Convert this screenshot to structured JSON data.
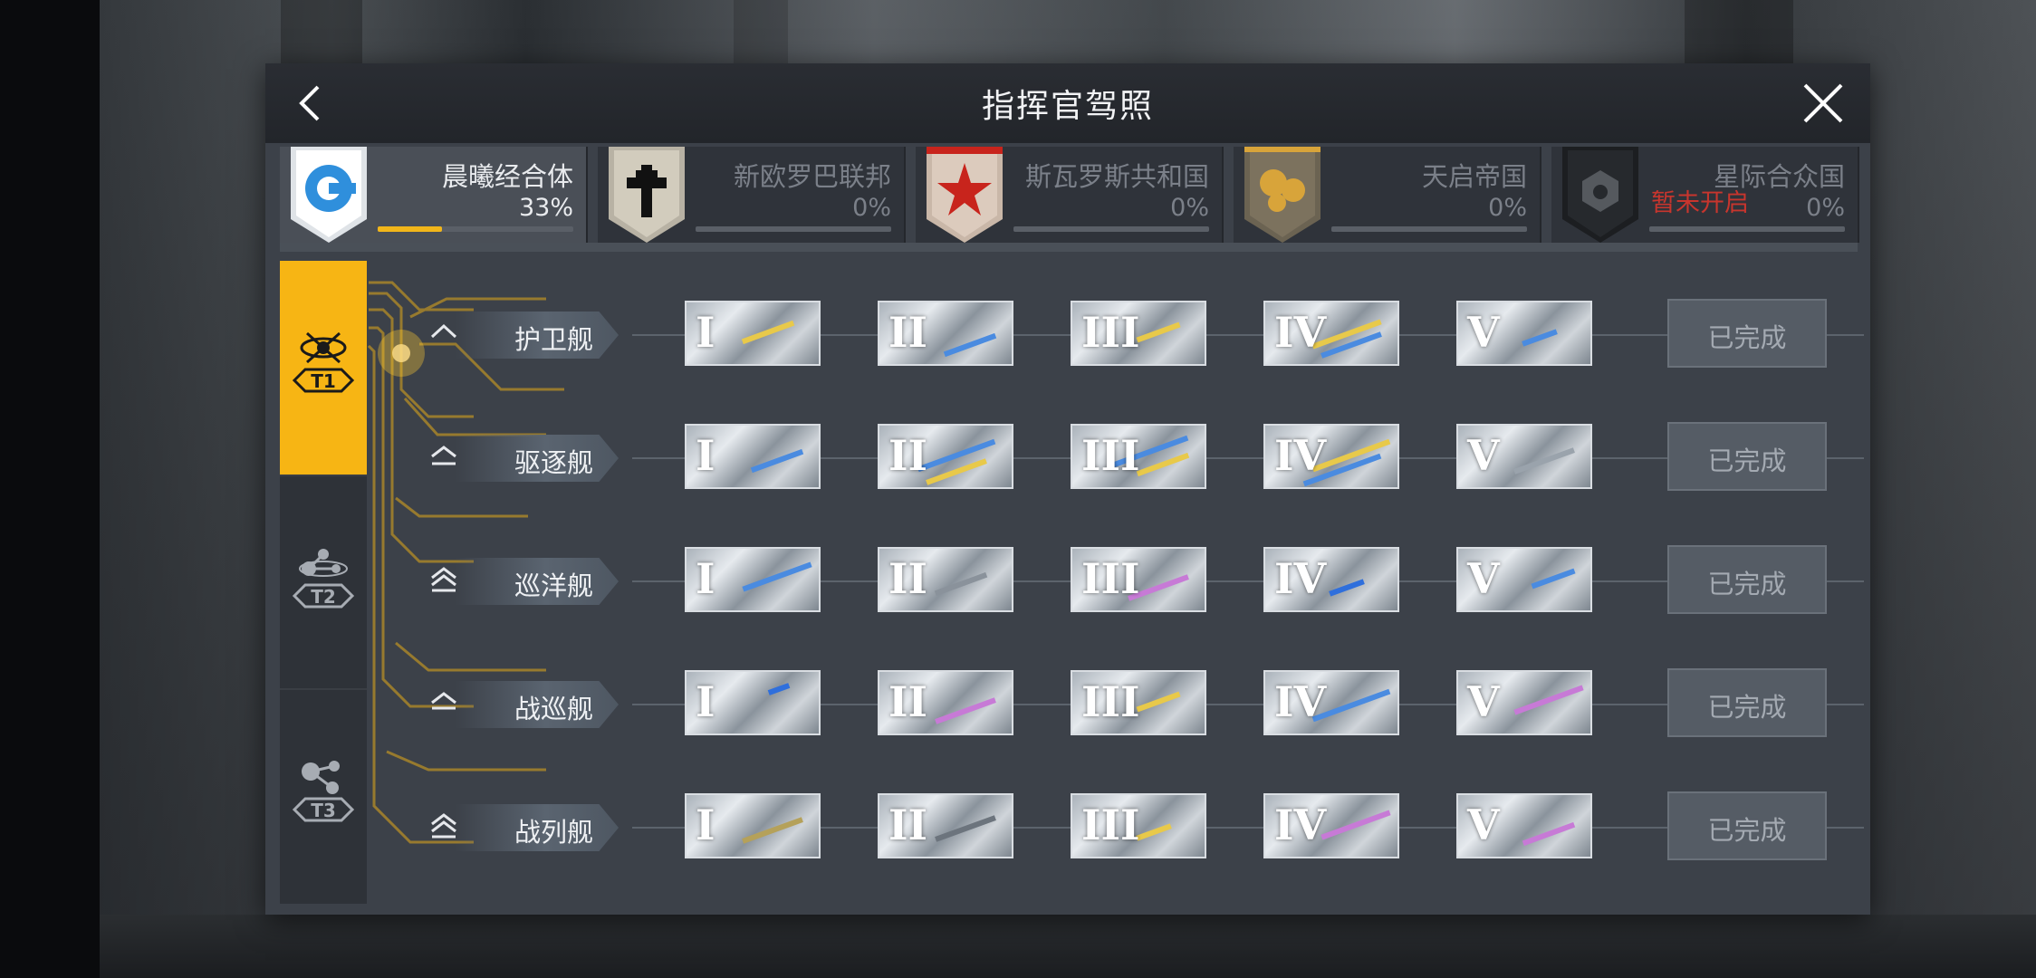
{
  "header": {
    "title": "指挥官驾照"
  },
  "factions": [
    {
      "name": "晨曦经合体",
      "percent": "33%",
      "progress": 0.33,
      "active": true,
      "emblem": "dawn-emblem-icon",
      "color": "#2f8fdc"
    },
    {
      "name": "新欧罗巴联邦",
      "percent": "0%",
      "progress": 0,
      "active": false,
      "emblem": "cross-emblem-icon",
      "color": "#111111"
    },
    {
      "name": "斯瓦罗斯共和国",
      "percent": "0%",
      "progress": 0,
      "active": false,
      "emblem": "star-emblem-icon",
      "color": "#c8241c"
    },
    {
      "name": "天启帝国",
      "percent": "0%",
      "progress": 0,
      "active": false,
      "emblem": "orbs-emblem-icon",
      "color": "#d8a43a"
    },
    {
      "name": "星际合众国",
      "percent": "0%",
      "progress": 0,
      "active": false,
      "emblem": "cube-emblem-icon",
      "color": "#222222",
      "locked_label": "暂未开启"
    }
  ],
  "tiers": [
    {
      "label": "T1",
      "active": true
    },
    {
      "label": "T2",
      "active": false
    },
    {
      "label": "T3",
      "active": false
    }
  ],
  "rows": [
    {
      "ship": "护卫舰",
      "status": "已完成",
      "levels": [
        "I",
        "II",
        "III",
        "IV",
        "V"
      ]
    },
    {
      "ship": "驱逐舰",
      "status": "已完成",
      "levels": [
        "I",
        "II",
        "III",
        "IV",
        "V"
      ]
    },
    {
      "ship": "巡洋舰",
      "status": "已完成",
      "levels": [
        "I",
        "II",
        "III",
        "IV",
        "V"
      ]
    },
    {
      "ship": "战巡舰",
      "status": "已完成",
      "levels": [
        "I",
        "II",
        "III",
        "IV",
        "V"
      ]
    },
    {
      "ship": "战列舰",
      "status": "已完成",
      "levels": [
        "I",
        "II",
        "III",
        "IV",
        "V"
      ]
    }
  ],
  "colors": {
    "accent": "#f7b514",
    "locked": "#c8352d"
  }
}
